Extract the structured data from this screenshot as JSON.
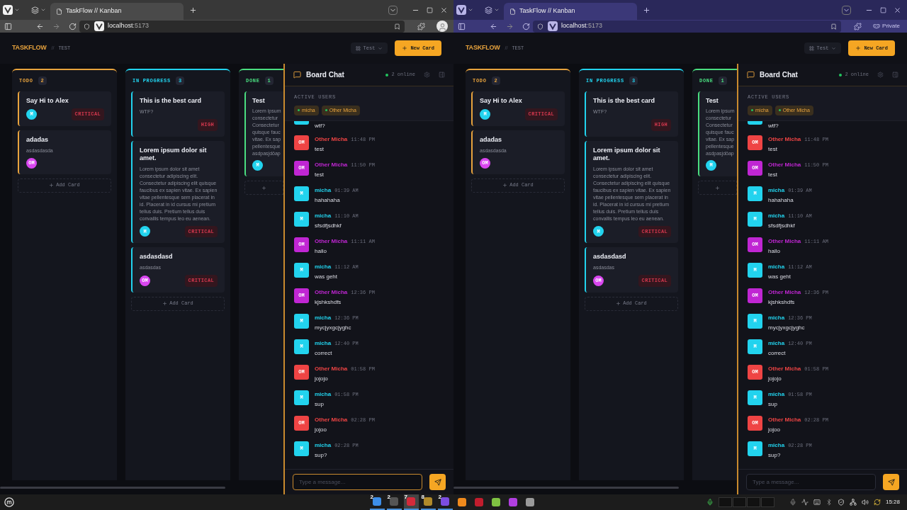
{
  "windows": [
    {
      "private": false,
      "tab_title": "TaskFlow // Kanban",
      "url_host": "localhost",
      "url_port": ":5173",
      "app": {
        "brand": "TASKFLOW",
        "separator": "//",
        "board_name": "TEST",
        "board_select": "Test",
        "new_card": "New Card",
        "columns": [
          {
            "title": "TODO",
            "count": "2",
            "color": "#e8a33d",
            "add_label": "Add Card",
            "cards": [
              {
                "title": "Say Hi to Alex",
                "avatar": {
                  "initials": "M",
                  "color": "#22d3ee"
                },
                "priority": "CRITICAL"
              },
              {
                "title": "adadas",
                "description": "asdasdasda",
                "avatar": {
                  "initials": "OM",
                  "color": "#d946ef"
                }
              }
            ]
          },
          {
            "title": "IN PROGRESS",
            "count": "3",
            "color": "#22d3ee",
            "add_label": "Add Card",
            "cards": [
              {
                "title": "This is the best card",
                "description": "WTF?",
                "priority": "HIGH"
              },
              {
                "title": "Lorem ipsum dolor sit amet.",
                "description": "Lorem ipsum dolor sit amet consectetur adipiscing elit. Consectetur adipiscing elit quisque faucibus ex sapien vitae. Ex sapien vitae pellentesque sem placerat in id. Placerat in id cursus mi pretium tellus duis. Pretium tellus duis convallis tempus leo eu aenean.",
                "avatar": {
                  "initials": "M",
                  "color": "#22d3ee"
                },
                "priority": "CRITICAL"
              },
              {
                "title": "asdasdasd",
                "description": "asdasdas",
                "avatar": {
                  "initials": "OM",
                  "color": "#d946ef"
                },
                "priority": "CRITICAL"
              }
            ]
          },
          {
            "title": "DONE",
            "count": "1",
            "color": "#4ade80",
            "cards": [
              {
                "title": "Test",
                "description_lines": [
                  "Lorem ipsum",
                  "consectetur",
                  "Consectetur",
                  "quisque fauc",
                  "vitae. Ex sap",
                  "pellentesque",
                  "asdpasjdöap"
                ],
                "avatar": {
                  "initials": "M",
                  "color": "#22d3ee"
                }
              }
            ]
          }
        ],
        "chat": {
          "title": "Board Chat",
          "online": "2 online",
          "active_label": "ACTIVE USERS",
          "active_users": [
            "micha",
            "Other Micha"
          ],
          "messages": [
            {
              "text": "wtf?",
              "color": "#22d3ee"
            },
            {
              "author": "Other Micha",
              "initials": "OM",
              "time": "11:48 PM",
              "text": "test",
              "color": "#ef4444"
            },
            {
              "author": "Other Micha",
              "initials": "OM",
              "time": "11:50 PM",
              "text": "test",
              "color": "#c026d3"
            },
            {
              "author": "micha",
              "initials": "M",
              "time": "01:39 AM",
              "text": "hahahaha",
              "color": "#22d3ee"
            },
            {
              "author": "micha",
              "initials": "M",
              "time": "11:10 AM",
              "text": "sfsdfjsdhkf",
              "color": "#22d3ee"
            },
            {
              "author": "Other Micha",
              "initials": "OM",
              "time": "11:11 AM",
              "text": "hallo",
              "color": "#c026d3"
            },
            {
              "author": "micha",
              "initials": "M",
              "time": "11:12 AM",
              "text": "was geht",
              "color": "#22d3ee"
            },
            {
              "author": "Other Micha",
              "initials": "OM",
              "time": "12:36 PM",
              "text": "kjshkshdfs",
              "color": "#c026d3"
            },
            {
              "author": "micha",
              "initials": "M",
              "time": "12:36 PM",
              "text": "mycjyxgcjyghc",
              "color": "#22d3ee"
            },
            {
              "author": "micha",
              "initials": "M",
              "time": "12:40 PM",
              "text": "correct",
              "color": "#22d3ee"
            },
            {
              "author": "Other Micha",
              "initials": "OM",
              "time": "01:58 PM",
              "text": "jojojo",
              "color": "#ef4444"
            },
            {
              "author": "micha",
              "initials": "M",
              "time": "01:58 PM",
              "text": "sup",
              "color": "#22d3ee"
            },
            {
              "author": "Other Micha",
              "initials": "OM",
              "time": "02:28 PM",
              "text": "jojoo",
              "color": "#ef4444"
            },
            {
              "author": "micha",
              "initials": "M",
              "time": "02:28 PM",
              "text": "sup?",
              "color": "#22d3ee"
            }
          ],
          "placeholder": "Type a message...",
          "focused": true
        }
      }
    },
    {
      "private": true,
      "tab_title": "TaskFlow // Kanban",
      "url_host": "localhost",
      "url_port": ":5173",
      "private_label": "Private",
      "app": {
        "brand": "TASKFLOW",
        "separator": "//",
        "board_name": "TEST",
        "board_select": "Test",
        "new_card": "New Card",
        "columns": [
          {
            "title": "TODO",
            "count": "2",
            "color": "#e8a33d",
            "add_label": "Add Card",
            "cards": [
              {
                "title": "Say Hi to Alex",
                "avatar": {
                  "initials": "M",
                  "color": "#22d3ee"
                },
                "priority": "CRITICAL"
              },
              {
                "title": "adadas",
                "description": "asdasdasda",
                "avatar": {
                  "initials": "OM",
                  "color": "#d946ef"
                }
              }
            ]
          },
          {
            "title": "IN PROGRESS",
            "count": "3",
            "color": "#22d3ee",
            "add_label": "Add Card",
            "cards": [
              {
                "title": "This is the best card",
                "description": "WTF?",
                "priority": "HIGH"
              },
              {
                "title": "Lorem ipsum dolor sit amet.",
                "description": "Lorem ipsum dolor sit amet consectetur adipiscing elit. Consectetur adipiscing elit quisque faucibus ex sapien vitae. Ex sapien vitae pellentesque sem placerat in id. Placerat in id cursus mi pretium tellus duis. Pretium tellus duis convallis tempus leo eu aenean.",
                "avatar": {
                  "initials": "M",
                  "color": "#22d3ee"
                },
                "priority": "CRITICAL"
              },
              {
                "title": "asdasdasd",
                "description": "asdasdas",
                "avatar": {
                  "initials": "OM",
                  "color": "#d946ef"
                },
                "priority": "CRITICAL"
              }
            ]
          },
          {
            "title": "DONE",
            "count": "1",
            "color": "#4ade80",
            "cards": [
              {
                "title": "Test",
                "description_lines": [
                  "Lorem ipsum",
                  "consectetur",
                  "Consectetur",
                  "quisque fauc",
                  "vitae. Ex sap",
                  "pellentesque",
                  "asdpasjdöap"
                ],
                "avatar": {
                  "initials": "M",
                  "color": "#22d3ee"
                }
              }
            ]
          }
        ],
        "chat": {
          "title": "Board Chat",
          "online": "2 online",
          "active_label": "ACTIVE USERS",
          "active_users": [
            "micha",
            "Other Micha"
          ],
          "messages": [
            {
              "text": "wtf?",
              "color": "#22d3ee"
            },
            {
              "author": "Other Micha",
              "initials": "OM",
              "time": "11:48 PM",
              "text": "test",
              "color": "#ef4444"
            },
            {
              "author": "Other Micha",
              "initials": "OM",
              "time": "11:50 PM",
              "text": "test",
              "color": "#c026d3"
            },
            {
              "author": "micha",
              "initials": "M",
              "time": "01:39 AM",
              "text": "hahahaha",
              "color": "#22d3ee"
            },
            {
              "author": "micha",
              "initials": "M",
              "time": "11:10 AM",
              "text": "sfsdfjsdhkf",
              "color": "#22d3ee"
            },
            {
              "author": "Other Micha",
              "initials": "OM",
              "time": "11:11 AM",
              "text": "hallo",
              "color": "#c026d3"
            },
            {
              "author": "micha",
              "initials": "M",
              "time": "11:12 AM",
              "text": "was geht",
              "color": "#22d3ee"
            },
            {
              "author": "Other Micha",
              "initials": "OM",
              "time": "12:36 PM",
              "text": "kjshkshdfs",
              "color": "#c026d3"
            },
            {
              "author": "micha",
              "initials": "M",
              "time": "12:36 PM",
              "text": "mycjyxgcjyghc",
              "color": "#22d3ee"
            },
            {
              "author": "micha",
              "initials": "M",
              "time": "12:40 PM",
              "text": "correct",
              "color": "#22d3ee"
            },
            {
              "author": "Other Micha",
              "initials": "OM",
              "time": "01:58 PM",
              "text": "jojojo",
              "color": "#ef4444"
            },
            {
              "author": "micha",
              "initials": "M",
              "time": "01:58 PM",
              "text": "sup",
              "color": "#22d3ee"
            },
            {
              "author": "Other Micha",
              "initials": "OM",
              "time": "02:28 PM",
              "text": "jojoo",
              "color": "#ef4444"
            },
            {
              "author": "micha",
              "initials": "M",
              "time": "02:28 PM",
              "text": "sup?",
              "color": "#22d3ee"
            }
          ],
          "placeholder": "Type a message...",
          "focused": false
        }
      }
    }
  ],
  "taskbar": {
    "apps": [
      {
        "count": "2",
        "color": "#3d8ee8",
        "selected": false
      },
      {
        "count": "2",
        "color": "#555555",
        "selected": false
      },
      {
        "count": "7",
        "color": "#d42a3a",
        "selected": true
      },
      {
        "count": "8",
        "color": "#b08a2a",
        "selected": false
      },
      {
        "count": "2",
        "color": "#7b4de0",
        "selected": false
      },
      {
        "color": "#f08a1c",
        "selected": false
      },
      {
        "color": "#c21d2d",
        "selected": false
      },
      {
        "color": "#7fc242",
        "selected": false
      },
      {
        "color": "#b13fe0",
        "selected": false
      },
      {
        "color": "#9a9a9a",
        "selected": false
      }
    ],
    "time": "15:28"
  }
}
